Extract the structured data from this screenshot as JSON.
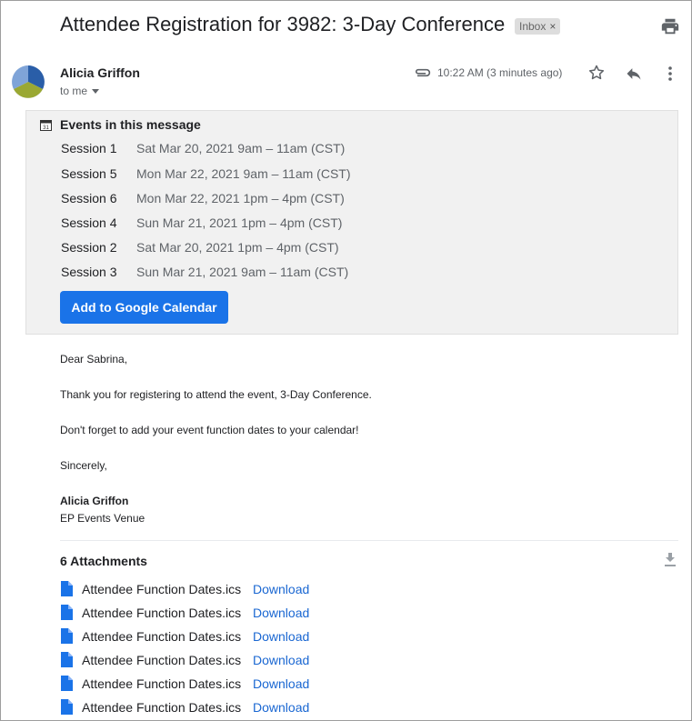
{
  "email": {
    "subject": "Attendee Registration for 3982: 3-Day Conference",
    "label_chip": "Inbox",
    "label_chip_close": "×",
    "sender_name": "Alicia Griffon",
    "recipient_line": "to me",
    "time": "10:22 AM (3 minutes ago)",
    "icons": [
      "print-icon",
      "avatar",
      "attachment-clip-icon",
      "star-icon",
      "reply-icon",
      "more-vert-icon",
      "calendar-icon",
      "download-icon",
      "file-icon"
    ]
  },
  "events": {
    "title": "Events in this message",
    "sessions": [
      {
        "name": "Session 1",
        "time": "Sat Mar 20, 2021 9am – 11am (CST)"
      },
      {
        "name": "Session 5",
        "time": "Mon Mar 22, 2021 9am – 11am (CST)"
      },
      {
        "name": "Session 6",
        "time": "Mon Mar 22, 2021 1pm – 4pm (CST)"
      },
      {
        "name": "Session 4",
        "time": "Sun Mar 21, 2021 1pm – 4pm (CST)"
      },
      {
        "name": "Session 2",
        "time": "Sat Mar 20, 2021 1pm – 4pm (CST)"
      },
      {
        "name": "Session 3",
        "time": "Sun Mar 21, 2021 9am – 11am (CST)"
      }
    ],
    "add_button": "Add to Google Calendar"
  },
  "body": {
    "greeting": "Dear Sabrina,",
    "line1": "Thank you for registering to attend the event, 3-Day Conference.",
    "line2": "Don't forget to add your event function dates to your calendar!",
    "closing": "Sincerely,",
    "signature_name": "Alicia Griffon",
    "signature_org": "EP Events Venue"
  },
  "attachments": {
    "title": "6 Attachments",
    "items": [
      {
        "name": "Attendee Function Dates.ics",
        "link": "Download"
      },
      {
        "name": "Attendee Function Dates.ics",
        "link": "Download"
      },
      {
        "name": "Attendee Function Dates.ics",
        "link": "Download"
      },
      {
        "name": "Attendee Function Dates.ics",
        "link": "Download"
      },
      {
        "name": "Attendee Function Dates.ics",
        "link": "Download"
      },
      {
        "name": "Attendee Function Dates.ics",
        "link": "Download"
      }
    ]
  },
  "colors": {
    "accent": "#1a73e8",
    "link": "#1a67d2",
    "events_bg": "#f1f1f1",
    "text": "#202124",
    "muted": "#5f6368"
  }
}
